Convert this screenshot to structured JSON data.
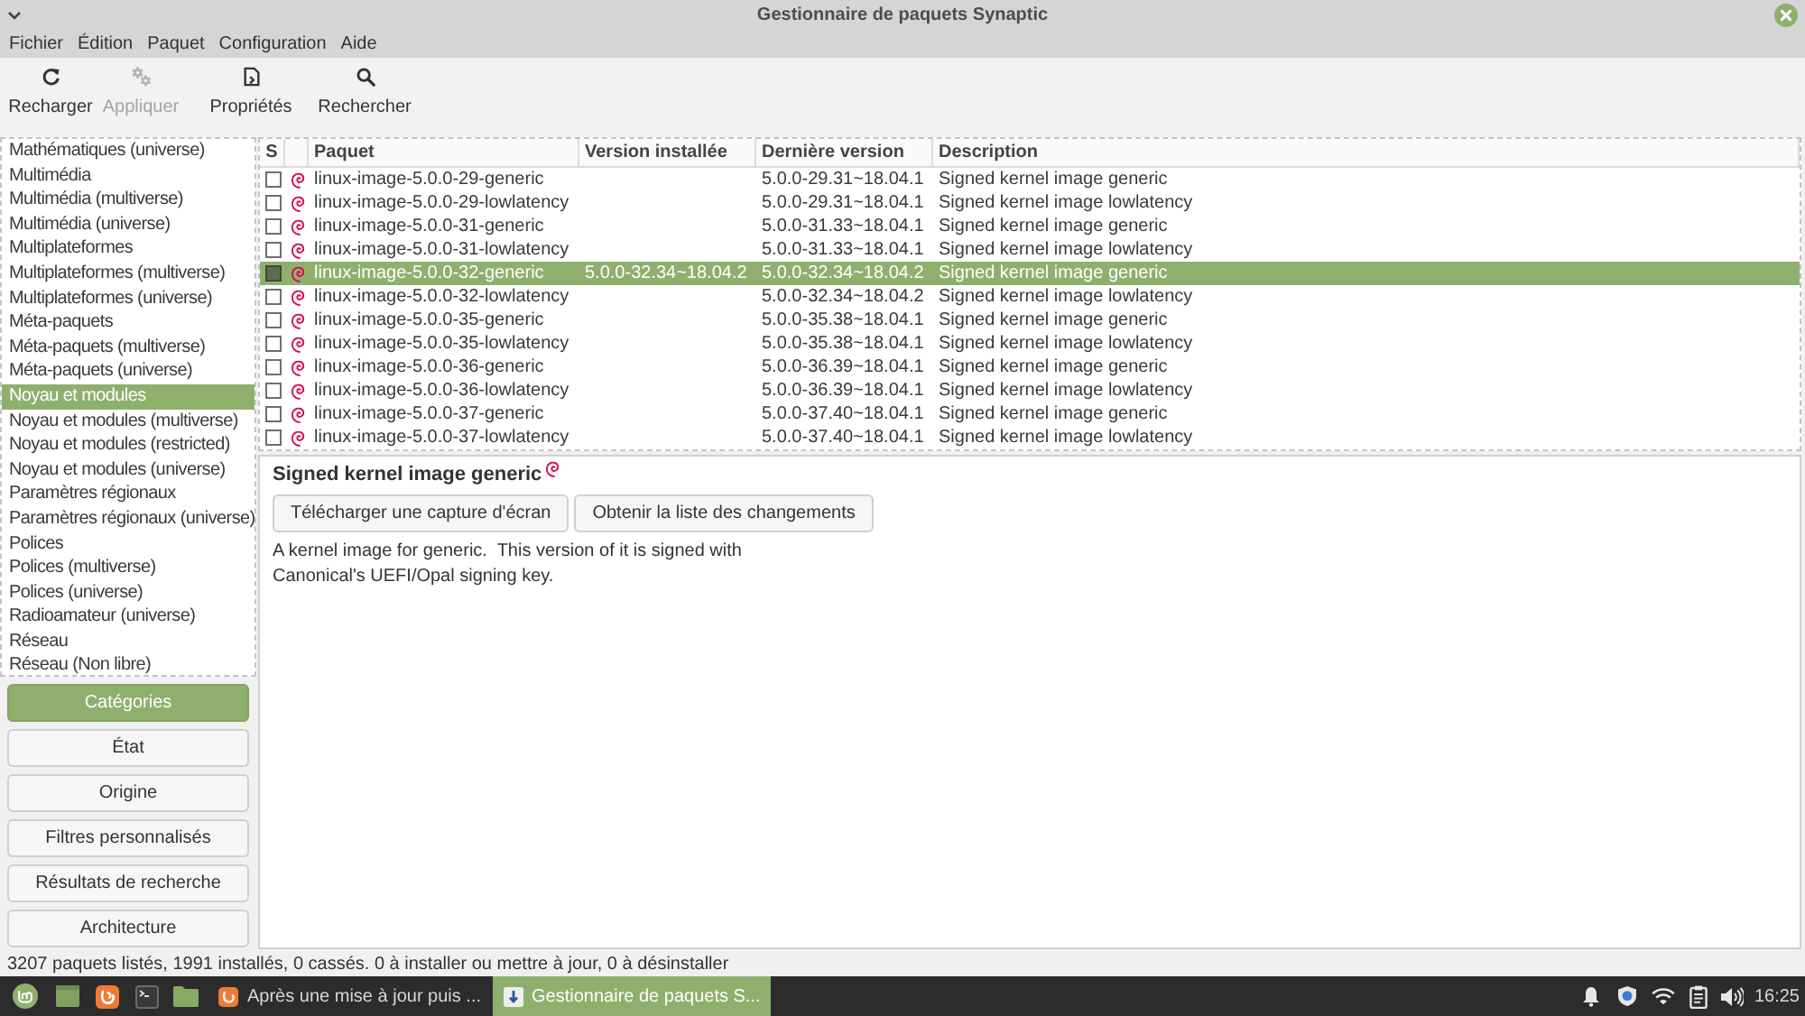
{
  "window": {
    "title": "Gestionnaire de paquets Synaptic"
  },
  "menu": [
    "Fichier",
    "Édition",
    "Paquet",
    "Configuration",
    "Aide"
  ],
  "toolbar": [
    {
      "label": "Recharger",
      "kind": "reload",
      "disabled": false
    },
    {
      "label": "Appliquer",
      "kind": "apply",
      "disabled": true
    },
    {
      "label": "Propriétés",
      "kind": "properties",
      "disabled": false
    },
    {
      "label": "Rechercher",
      "kind": "search",
      "disabled": false
    }
  ],
  "sidebar": {
    "categories": [
      {
        "label": "Mathématiques (universe)",
        "selected": false
      },
      {
        "label": "Multimédia",
        "selected": false
      },
      {
        "label": "Multimédia (multiverse)",
        "selected": false
      },
      {
        "label": "Multimédia (universe)",
        "selected": false
      },
      {
        "label": "Multiplateformes",
        "selected": false
      },
      {
        "label": "Multiplateformes (multiverse)",
        "selected": false
      },
      {
        "label": "Multiplateformes (universe)",
        "selected": false
      },
      {
        "label": "Méta-paquets",
        "selected": false
      },
      {
        "label": "Méta-paquets (multiverse)",
        "selected": false
      },
      {
        "label": "Méta-paquets (universe)",
        "selected": false
      },
      {
        "label": "Noyau et modules",
        "selected": true
      },
      {
        "label": "Noyau et modules (multiverse)",
        "selected": false
      },
      {
        "label": "Noyau et modules (restricted)",
        "selected": false
      },
      {
        "label": "Noyau et modules (universe)",
        "selected": false
      },
      {
        "label": "Paramètres régionaux",
        "selected": false
      },
      {
        "label": "Paramètres régionaux (universe)",
        "selected": false
      },
      {
        "label": "Polices",
        "selected": false
      },
      {
        "label": "Polices (multiverse)",
        "selected": false
      },
      {
        "label": "Polices (universe)",
        "selected": false
      },
      {
        "label": "Radioamateur (universe)",
        "selected": false
      },
      {
        "label": "Réseau",
        "selected": false
      },
      {
        "label": "Réseau (Non libre)",
        "selected": false
      }
    ],
    "views": [
      {
        "label": "Catégories",
        "selected": true
      },
      {
        "label": "État",
        "selected": false
      },
      {
        "label": "Origine",
        "selected": false
      },
      {
        "label": "Filtres personnalisés",
        "selected": false
      },
      {
        "label": "Résultats de recherche",
        "selected": false
      },
      {
        "label": "Architecture",
        "selected": false
      }
    ]
  },
  "table": {
    "columns": [
      "S",
      "Paquet",
      "Version installée",
      "Dernière version",
      "Description"
    ],
    "rows": [
      {
        "package": "linux-image-5.0.0-29-generic",
        "latest_version": "5.0.0-29.31~18.04.1",
        "description": "Signed kernel image generic",
        "installed": false,
        "selected": false
      },
      {
        "package": "linux-image-5.0.0-29-lowlatency",
        "latest_version": "5.0.0-29.31~18.04.1",
        "description": "Signed kernel image lowlatency",
        "installed": false,
        "selected": false
      },
      {
        "package": "linux-image-5.0.0-31-generic",
        "latest_version": "5.0.0-31.33~18.04.1",
        "description": "Signed kernel image generic",
        "installed": false,
        "selected": false
      },
      {
        "package": "linux-image-5.0.0-31-lowlatency",
        "latest_version": "5.0.0-31.33~18.04.1",
        "description": "Signed kernel image lowlatency",
        "installed": false,
        "selected": false
      },
      {
        "package": "linux-image-5.0.0-32-generic",
        "installed_version": "5.0.0-32.34~18.04.2",
        "latest_version": "5.0.0-32.34~18.04.2",
        "description": "Signed kernel image generic",
        "installed": true,
        "selected": true
      },
      {
        "package": "linux-image-5.0.0-32-lowlatency",
        "latest_version": "5.0.0-32.34~18.04.2",
        "description": "Signed kernel image lowlatency",
        "installed": false,
        "selected": false
      },
      {
        "package": "linux-image-5.0.0-35-generic",
        "latest_version": "5.0.0-35.38~18.04.1",
        "description": "Signed kernel image generic",
        "installed": false,
        "selected": false
      },
      {
        "package": "linux-image-5.0.0-35-lowlatency",
        "latest_version": "5.0.0-35.38~18.04.1",
        "description": "Signed kernel image lowlatency",
        "installed": false,
        "selected": false
      },
      {
        "package": "linux-image-5.0.0-36-generic",
        "latest_version": "5.0.0-36.39~18.04.1",
        "description": "Signed kernel image generic",
        "installed": false,
        "selected": false
      },
      {
        "package": "linux-image-5.0.0-36-lowlatency",
        "latest_version": "5.0.0-36.39~18.04.1",
        "description": "Signed kernel image lowlatency",
        "installed": false,
        "selected": false
      },
      {
        "package": "linux-image-5.0.0-37-generic",
        "latest_version": "5.0.0-37.40~18.04.1",
        "description": "Signed kernel image generic",
        "installed": false,
        "selected": false
      },
      {
        "package": "linux-image-5.0.0-37-lowlatency",
        "latest_version": "5.0.0-37.40~18.04.1",
        "description": "Signed kernel image lowlatency",
        "installed": false,
        "selected": false
      }
    ]
  },
  "details": {
    "title": "Signed kernel image generic",
    "buttons": [
      "Télécharger une capture d'écran",
      "Obtenir la liste des changements"
    ],
    "description": "A kernel image for generic.  This version of it is signed with\nCanonical's UEFI/Opal signing key."
  },
  "status_bar": {
    "text": "3207 paquets listés, 1991 installés, 0 cassés. 0 à installer ou mettre à jour, 0 à désinstaller"
  },
  "taskbar": {
    "tasks": [
      {
        "label": "Après une mise à jour puis ...",
        "kind": "browser",
        "selected": false
      },
      {
        "label": "Gestionnaire de paquets S...",
        "kind": "package-manager",
        "selected": true
      }
    ],
    "clock": "16:25"
  }
}
